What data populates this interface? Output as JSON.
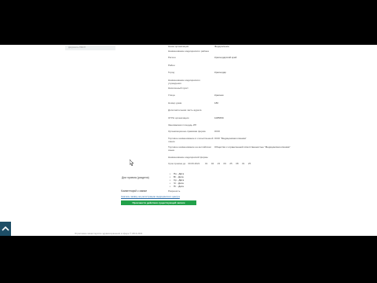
{
  "sidebar": {
    "tab_label": "Документы ПМСП"
  },
  "form_rows": [
    {
      "label": "Наша организация",
      "value": "Федеральное"
    },
    {
      "label": "Наименование медицинского района",
      "value": ""
    },
    {
      "label": "Регион",
      "value": "Краснодарский край"
    },
    {
      "label": "Район",
      "value": ""
    },
    {
      "label": "Город",
      "value": "Краснодар"
    },
    {
      "label": "Наименование медицинского учреждения",
      "value": ""
    },
    {
      "label": "Населенный пункт",
      "value": ""
    },
    {
      "label": "Улица",
      "value": "Красная"
    },
    {
      "label": "Номер дома",
      "value": "180"
    },
    {
      "label": "Дополнительная часть адреса",
      "value": ""
    },
    {
      "label": "ОГРН организации",
      "value": "1085659"
    },
    {
      "label": "Занимаемая площадь ИП",
      "value": ""
    },
    {
      "label": "Организационно-правовая форма",
      "value": "ООО"
    },
    {
      "label": "Торговое наименование в отечественной линии",
      "value": "ООО \"Медицинская клиника\""
    },
    {
      "label": "Торговое наименование на английском языке",
      "value": "Общество с ограниченной ответственностью \"Медицинская клиника\""
    },
    {
      "label": "Наименование медицинской фирмы",
      "value": ""
    }
  ],
  "date_row": {
    "label": "Срок приема до",
    "date": "30.09.2021",
    "numbers": [
      "01",
      "04",
      "23",
      "09",
      "25",
      "08",
      "01",
      "25"
    ]
  },
  "days": {
    "label": "Дни приема (раздела)",
    "items": [
      "Пн - Дата",
      "Вт - Дата",
      "Ср - Дата",
      "Чт - Дата",
      "Пт - Дата"
    ]
  },
  "comment": {
    "label": "Комментарий к заявке",
    "value": "Разрешить",
    "link_text": "Скачать заявку на регистрацию медицинского центра"
  },
  "submit_label": "Произвести действия существующей записи",
  "footer_text": "Отраслевое министерство здравоохранения в сфере © 2013-2021",
  "colors": {
    "accent": "#22a14a",
    "scroll_button": "#1e4e66",
    "link": "#2a6aa8"
  },
  "icons": {
    "scroll_top": "chevron-up-icon",
    "cursor": "mouse-pointer-icon"
  }
}
